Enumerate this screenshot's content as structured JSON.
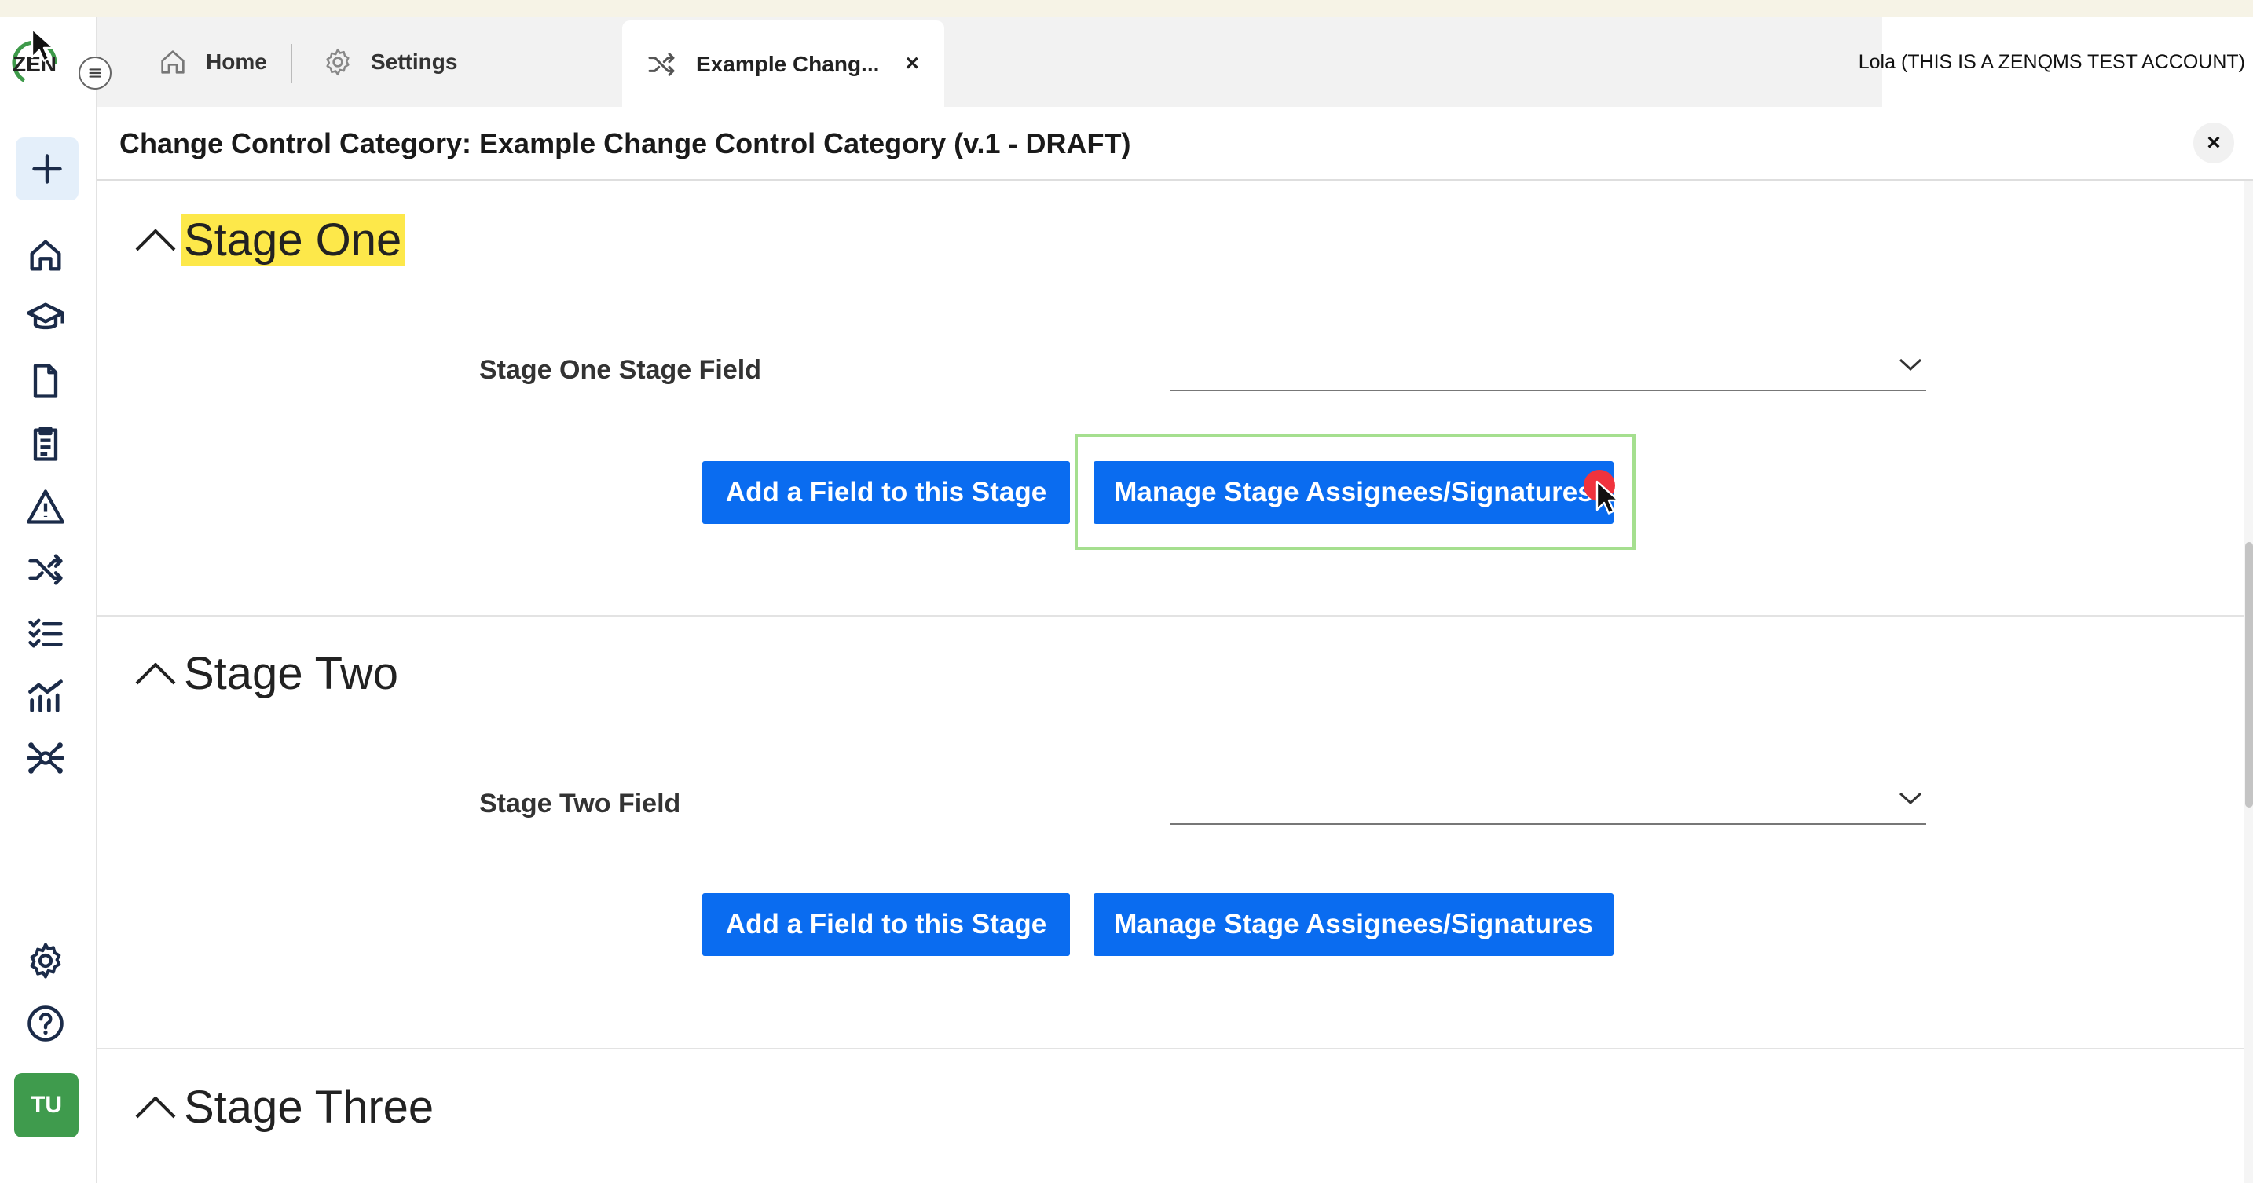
{
  "logo": {
    "text": "ZEN"
  },
  "tabs": {
    "home_label": "Home",
    "settings_label": "Settings",
    "active_label": "Example Chang...",
    "active_close": "×"
  },
  "account": {
    "label": "Lola (THIS IS A ZENQMS TEST ACCOUNT)"
  },
  "header": {
    "title": "Change Control Category: Example Change Control Category (v.1 - DRAFT)",
    "close": "×"
  },
  "sidebar": {
    "items": [
      {
        "icon": "plus-icon"
      },
      {
        "icon": "home-icon"
      },
      {
        "icon": "graduation-cap-icon"
      },
      {
        "icon": "document-icon"
      },
      {
        "icon": "clipboard-checklist-icon"
      },
      {
        "icon": "warning-triangle-icon"
      },
      {
        "icon": "shuffle-icon"
      },
      {
        "icon": "checklist-icon"
      },
      {
        "icon": "chart-icon"
      },
      {
        "icon": "network-icon"
      },
      {
        "icon": "gear-icon"
      },
      {
        "icon": "help-icon"
      }
    ],
    "avatar": "TU"
  },
  "stages": [
    {
      "title": "Stage One",
      "field_label": "Stage One Stage Field",
      "add_button": "Add a Field to this Stage",
      "manage_button": "Manage Stage Assignees/Signatures"
    },
    {
      "title": "Stage Two",
      "field_label": "Stage Two Field",
      "add_button": "Add a Field to this Stage",
      "manage_button": "Manage Stage Assignees/Signatures"
    },
    {
      "title": "Stage Three"
    }
  ],
  "colors": {
    "primary_button": "#0a6cf0",
    "highlight": "#fde84a",
    "focus_ring": "#a5df8f",
    "avatar_bg": "#3f9b4d",
    "click_marker": "#f0333d"
  }
}
